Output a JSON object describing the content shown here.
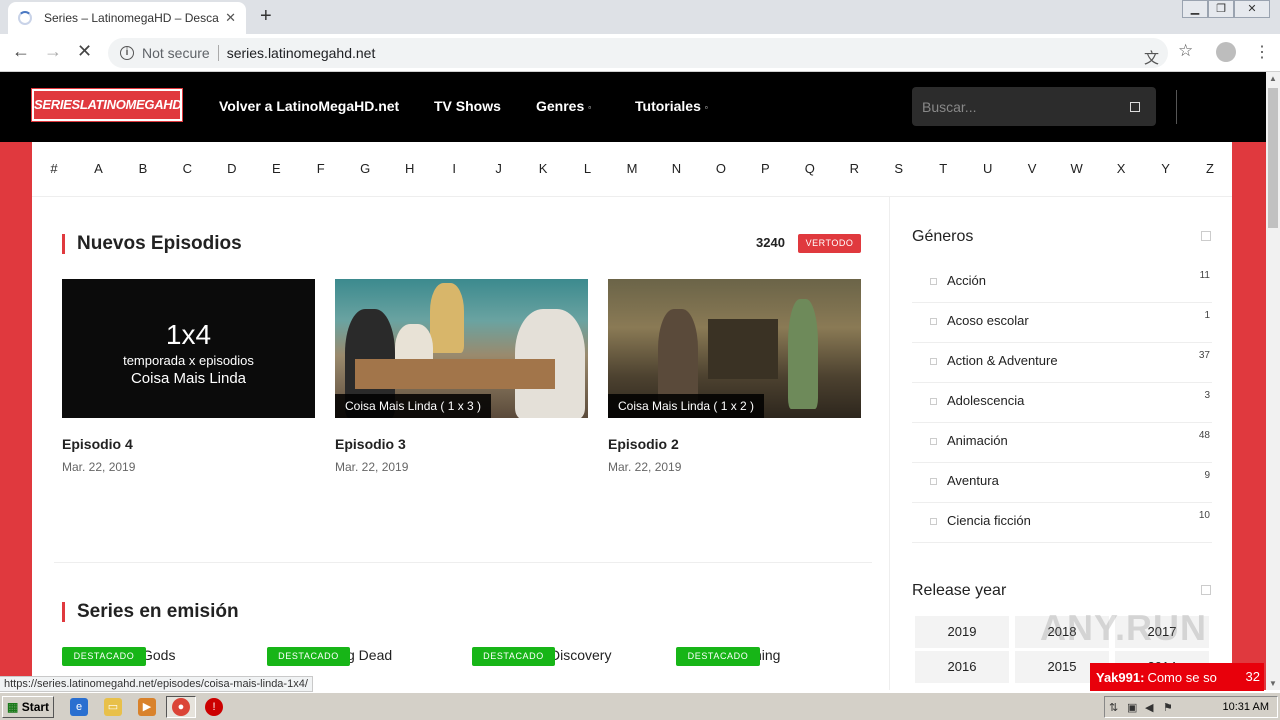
{
  "browser": {
    "tab_title": "Series – LatinomegaHD – Descarga s",
    "not_secure": "Not secure",
    "url": "series.latinomegahd.net",
    "status_url": "https://series.latinomegahd.net/episodes/coisa-mais-linda-1x4/"
  },
  "header": {
    "logo": "SERIESLATINOMEGAHD",
    "nav": [
      {
        "label": "Volver a LatinoMegaHD.net"
      },
      {
        "label": "TV Shows"
      },
      {
        "label": "Genres",
        "has_caret": true
      },
      {
        "label": "Tutoriales",
        "has_caret": true
      }
    ],
    "search_placeholder": "Buscar..."
  },
  "letters": [
    "#",
    "A",
    "B",
    "C",
    "D",
    "E",
    "F",
    "G",
    "H",
    "I",
    "J",
    "K",
    "L",
    "M",
    "N",
    "O",
    "P",
    "Q",
    "R",
    "S",
    "T",
    "U",
    "V",
    "W",
    "X",
    "Y",
    "Z"
  ],
  "new_episodes": {
    "title": "Nuevos Episodios",
    "count": "3240",
    "see_all": "VERTODO",
    "cards": [
      {
        "thumb_big": "1x4",
        "thumb_mid": "temporada x episodios",
        "thumb_name": "Coisa Mais Linda",
        "title": "Episodio 4",
        "date": "Mar. 22, 2019"
      },
      {
        "label": "Coisa Mais Linda ( 1 x 3 )",
        "title": "Episodio 3",
        "date": "Mar. 22, 2019"
      },
      {
        "label": "Coisa Mais Linda ( 1 x 2 )",
        "title": "Episodio 2",
        "date": "Mar. 22, 2019"
      }
    ]
  },
  "series_airing": {
    "title": "Series en emisión",
    "badge": "DESTACADO",
    "items": [
      "Gods",
      "g Dead",
      "Discovery",
      "ning"
    ]
  },
  "sidebar": {
    "genres_title": "Géneros",
    "genres": [
      {
        "name": "Acción",
        "count": "11"
      },
      {
        "name": "Acoso escolar",
        "count": "1"
      },
      {
        "name": "Action & Adventure",
        "count": "37"
      },
      {
        "name": "Adolescencia",
        "count": "3"
      },
      {
        "name": "Animación",
        "count": "48"
      },
      {
        "name": "Aventura",
        "count": "9"
      },
      {
        "name": "Ciencia ficción",
        "count": "10"
      }
    ],
    "release_title": "Release year",
    "years": [
      "2019",
      "2018",
      "2017",
      "2016",
      "2015",
      "2014"
    ]
  },
  "overlay": {
    "watermark": "ANY.RUN",
    "chat_user": "Yak991:",
    "chat_text": "Como se so",
    "chat_count": "32"
  },
  "taskbar": {
    "start": "Start",
    "clock": "10:31 AM"
  },
  "colors": {
    "accent_red": "#e0393e",
    "badge_green": "#17b517",
    "header_black": "#000000"
  }
}
